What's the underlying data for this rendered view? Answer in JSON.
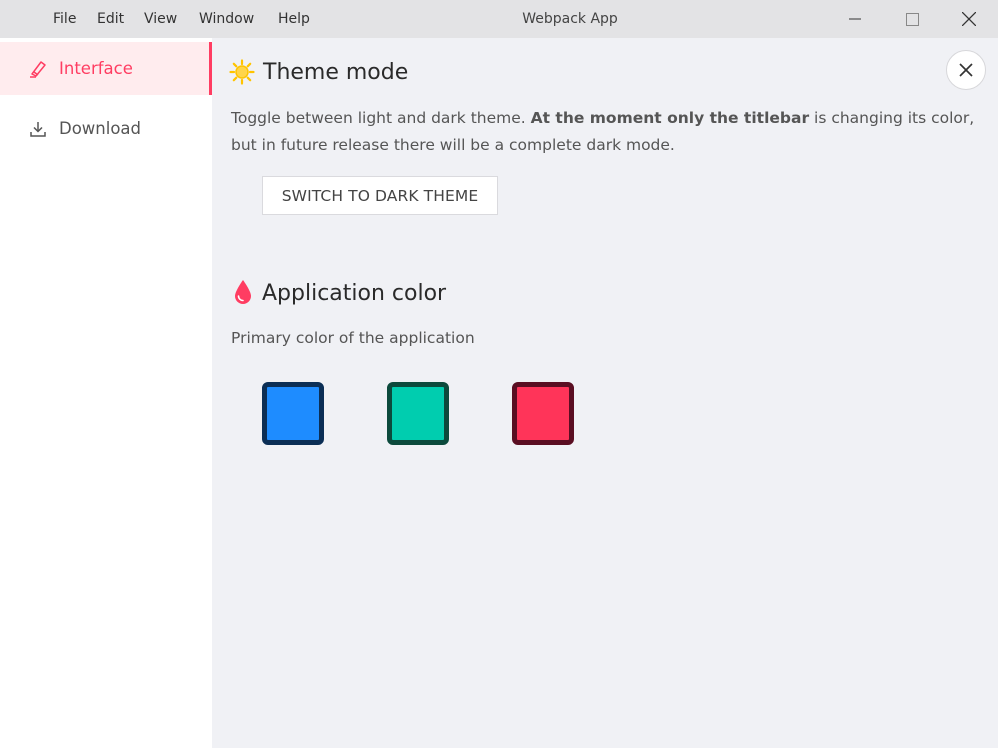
{
  "titlebar": {
    "title": "Webpack App",
    "menu": [
      "File",
      "Edit",
      "View",
      "Window",
      "Help"
    ],
    "controls": [
      "minimize-icon",
      "maximize-icon",
      "close-icon"
    ]
  },
  "sidebar": {
    "items": [
      {
        "label": "Interface",
        "icon": "brush-icon",
        "active": true
      },
      {
        "label": "Download",
        "icon": "download-icon",
        "active": false
      }
    ]
  },
  "main": {
    "close_icon": "close-icon",
    "theme": {
      "icon": "sun-icon",
      "title": "Theme mode",
      "desc_prefix": "Toggle between light and dark theme. ",
      "desc_bold": "At the moment only the titlebar",
      "desc_suffix": " is changing its color, but in future release there will be a complete dark mode.",
      "button_label": "SWITCH TO DARK THEME"
    },
    "color": {
      "icon": "drop-icon",
      "title": "Application color",
      "desc": "Primary color of the application",
      "swatches": [
        {
          "name": "blue",
          "fill": "#1e8cff",
          "border": "#0b2e55"
        },
        {
          "name": "green",
          "fill": "#00cdaf",
          "border": "#0c4a3c"
        },
        {
          "name": "red",
          "fill": "#ff3459",
          "border": "#5a0e22"
        }
      ]
    }
  },
  "colors": {
    "accent": "#ff3d62",
    "sun": "#ffc400",
    "drop": "#ff3d62"
  }
}
